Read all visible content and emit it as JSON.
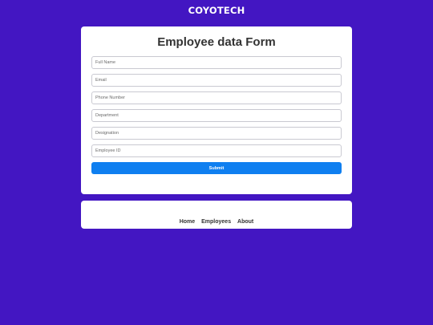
{
  "brand": {
    "name": "COYOTECH"
  },
  "form": {
    "title": "Employee data Form",
    "fields": [
      {
        "placeholder": "Full Name",
        "value": ""
      },
      {
        "placeholder": "Email",
        "value": ""
      },
      {
        "placeholder": "Phone Number",
        "value": ""
      },
      {
        "placeholder": "Department",
        "value": ""
      },
      {
        "placeholder": "Designation",
        "value": ""
      },
      {
        "placeholder": "Employee ID",
        "value": ""
      }
    ],
    "submit_label": "Submit"
  },
  "nav": {
    "items": [
      {
        "label": "Home"
      },
      {
        "label": "Employees"
      },
      {
        "label": "About"
      }
    ]
  },
  "colors": {
    "page_background": "#4316c2",
    "card_background": "#ffffff",
    "submit_button": "#0f7ff0",
    "text": "#333333"
  }
}
